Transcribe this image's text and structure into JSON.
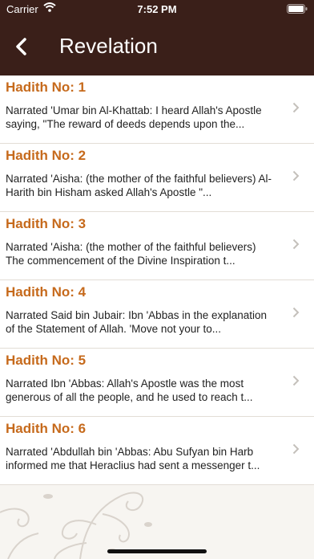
{
  "status_bar": {
    "carrier": "Carrier",
    "time": "7:52 PM"
  },
  "nav": {
    "title": "Revelation"
  },
  "hadiths": [
    {
      "title": "Hadith No: 1",
      "line1": "Narrated 'Umar bin Al-Khattab: I heard Allah's Apostle",
      "line2": "saying, \"The reward of deeds depends upon the..."
    },
    {
      "title": "Hadith No: 2",
      "line1": "Narrated 'Aisha: (the mother of the faithful believers) Al-",
      "line2": "Harith bin Hisham asked Allah's Apostle \"..."
    },
    {
      "title": "Hadith No: 3",
      "line1": "Narrated 'Aisha: (the mother of the faithful believers)",
      "line2": "The commencement of the Divine Inspiration t..."
    },
    {
      "title": "Hadith No: 4",
      "line1": "Narrated Said bin Jubair: Ibn 'Abbas in the explanation",
      "line2": "of the Statement of Allah. 'Move not your to..."
    },
    {
      "title": "Hadith No: 5",
      "line1": "Narrated Ibn 'Abbas: Allah's Apostle was the most",
      "line2": "generous of all the people, and he used to reach t..."
    },
    {
      "title": "Hadith No: 6",
      "line1": "Narrated 'Abdullah bin 'Abbas: Abu Sufyan bin Harb",
      "line2": "informed me that Heraclius had sent a messenger t..."
    }
  ],
  "icons": {
    "back": "chevron-left-icon",
    "row": "chevron-right-icon"
  }
}
